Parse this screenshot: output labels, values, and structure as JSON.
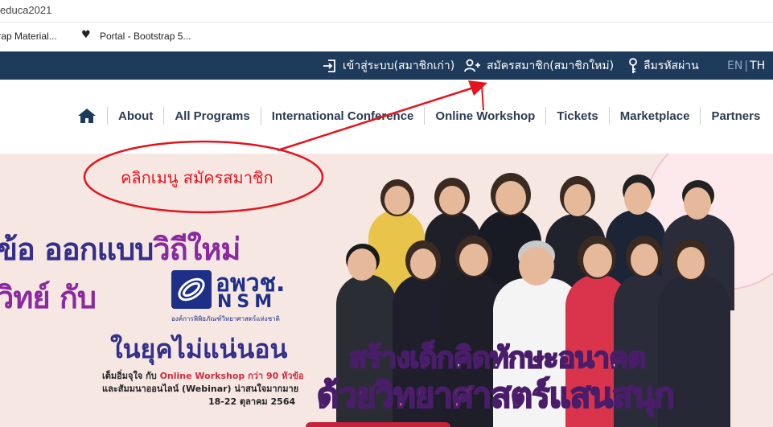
{
  "browser": {
    "url_fragment": "educa2021",
    "bookmarks": [
      "trap Material...",
      "Portal - Bootstrap 5..."
    ]
  },
  "topbar": {
    "login": "เข้าสู่ระบบ(สมาชิกเก่า)",
    "register": "สมัครสมาชิก(สมาชิกใหม่)",
    "forgot": "ลืมรหัสผ่าน",
    "lang_en": "EN",
    "lang_sep": "|",
    "lang_th": "TH"
  },
  "nav": {
    "items": [
      "About",
      "All Programs",
      "International Conference",
      "Online Workshop",
      "Tickets",
      "Marketplace",
      "Partners"
    ]
  },
  "banner": {
    "line1_a": "ข้อ ออกแบบ",
    "line1_b": "วิถีใหม่",
    "line2": "วิทย์ กับ",
    "logo_th": "อพวช.",
    "logo_en": "NSM",
    "logo_sub": "องค์การพิพิธภัณฑ์วิทยาศาสตร์แห่งชาติ",
    "line3": "ในยุคไม่แน่นอน",
    "small1_a": "เต็มอิ่มจุใจ กับ ",
    "small1_b": "Online Workshop กว่า 90 หัวข้อ",
    "small2": "และสัมมนาออนไลน์ (Webinar) น่าสนใจมากมาย",
    "small3": "18-22 ตุลาคม 2564",
    "slogan1": "สร้างเด็กคิดทักษะอนาคต",
    "slogan2": "ด้วยวิทยาศาสตร์แสนสนุก"
  },
  "annotation": {
    "text": "คลิกเมนู สมัครสมาชิก",
    "color": "#e3141f"
  },
  "colors": {
    "topbar": "#1f3b5c",
    "nav_text": "#2b3b52",
    "banner_bg": "#f6e7e3",
    "brand_purple": "#34308a",
    "accent_pink": "#e34372"
  }
}
